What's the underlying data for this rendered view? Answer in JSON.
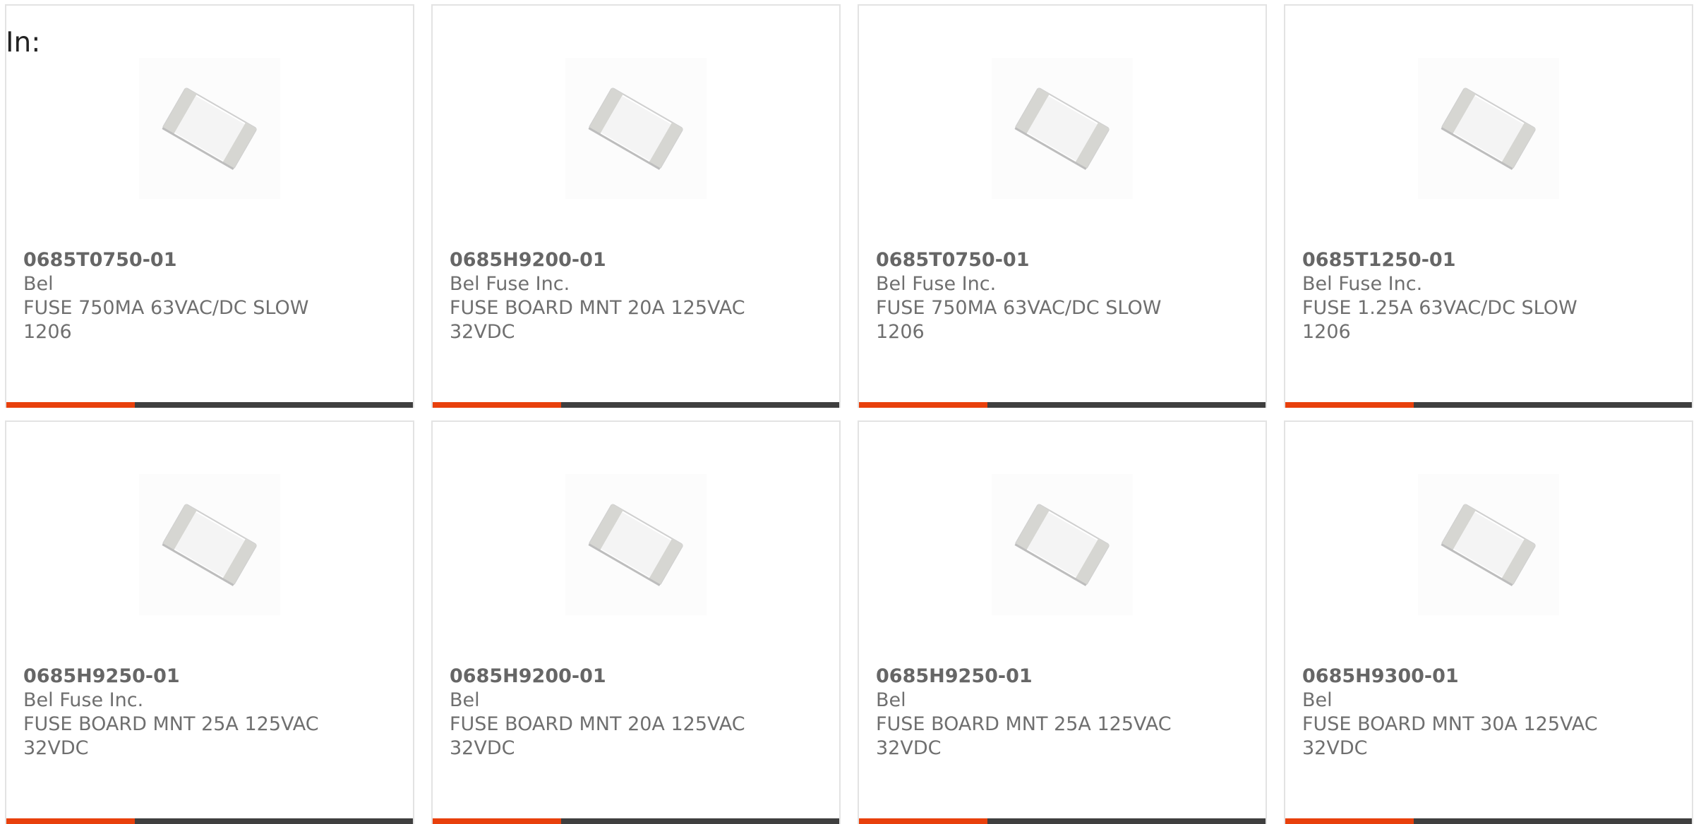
{
  "page": {
    "label": "In:"
  },
  "theme": {
    "accent": "#e8400c",
    "bar": "#3f3f3f",
    "card_border": "#e3e3e3",
    "text": "#6f6f6f"
  },
  "products": [
    {
      "part_number": "0685T0750-01",
      "manufacturer": "Bel",
      "description": "FUSE 750MA 63VAC/DC SLOW 1206",
      "image_icon": "smd-fuse-chip-icon"
    },
    {
      "part_number": "0685H9200-01",
      "manufacturer": "Bel Fuse Inc.",
      "description": "FUSE BOARD MNT 20A 125VAC 32VDC",
      "image_icon": "smd-fuse-chip-icon"
    },
    {
      "part_number": "0685T0750-01",
      "manufacturer": "Bel Fuse Inc.",
      "description": "FUSE 750MA 63VAC/DC SLOW 1206",
      "image_icon": "smd-fuse-chip-icon"
    },
    {
      "part_number": "0685T1250-01",
      "manufacturer": "Bel Fuse Inc.",
      "description": "FUSE 1.25A 63VAC/DC SLOW 1206",
      "image_icon": "smd-fuse-chip-icon"
    },
    {
      "part_number": "0685H9250-01",
      "manufacturer": "Bel Fuse Inc.",
      "description": "FUSE BOARD MNT 25A 125VAC 32VDC",
      "image_icon": "smd-fuse-chip-icon"
    },
    {
      "part_number": "0685H9200-01",
      "manufacturer": "Bel",
      "description": "FUSE BOARD MNT 20A 125VAC 32VDC",
      "image_icon": "smd-fuse-chip-icon"
    },
    {
      "part_number": "0685H9250-01",
      "manufacturer": "Bel",
      "description": "FUSE BOARD MNT 25A 125VAC 32VDC",
      "image_icon": "smd-fuse-chip-icon"
    },
    {
      "part_number": "0685H9300-01",
      "manufacturer": "Bel",
      "description": "FUSE BOARD MNT 30A 125VAC 32VDC",
      "image_icon": "smd-fuse-chip-icon"
    }
  ]
}
